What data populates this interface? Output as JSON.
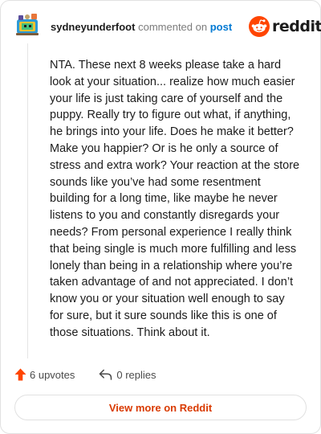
{
  "header": {
    "username": "sydneyunderfoot",
    "action_text": "commented on",
    "post_link": "post",
    "logo_text": "reddit",
    "logo_icon": "reddit-snoo-icon",
    "avatar_icon": "user-avatar"
  },
  "comment": {
    "body": "NTA. These next 8 weeks please take a hard look at your situation... realize how much easier your life is just taking care of yourself and the puppy. Really try to figure out what, if anything, he brings into your life. Does he make it better? Make you happier? Or is he only a source of stress and extra work? Your reaction at the store sounds like you’ve had some resentment building for a long time, like maybe he never listens to you and constantly disregards your needs? From personal experience I really think that being single is much more fulfilling and less lonely than being in a relationship where you’re taken advantage of and not appreciated. I don’t know you or your situation well enough to say for sure, but it sure sounds like this is one of those situations. Think about it."
  },
  "actions": {
    "upvotes_label": "6 upvotes",
    "replies_label": "0 replies"
  },
  "footer": {
    "view_more_label": "View more on Reddit"
  },
  "colors": {
    "accent": "#ff4500",
    "link": "#0079d3",
    "view_more": "#d93a00"
  }
}
